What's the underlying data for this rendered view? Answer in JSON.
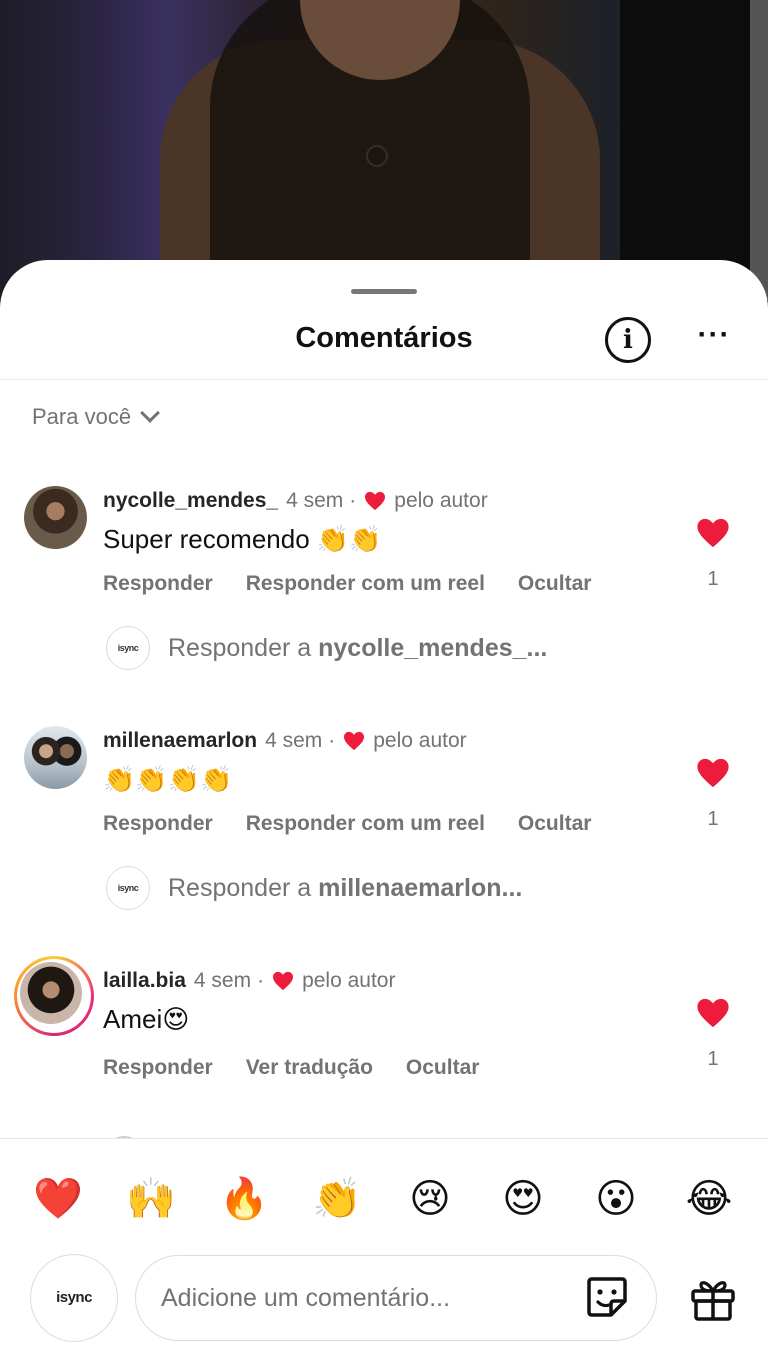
{
  "sheet": {
    "title": "Comentários",
    "info_icon": "info-icon",
    "more_icon": "more-horizontal-icon",
    "more_label": "···"
  },
  "filter": {
    "label": "Para você",
    "icon": "chevron-down-icon"
  },
  "comments": [
    {
      "username": "nycolle_mendes_",
      "time": "4 sem",
      "separator": "·",
      "liked_by_author": "pelo autor",
      "text": "Super recomendo 👏👏",
      "actions": [
        "Responder",
        "Responder com um reel",
        "Ocultar"
      ],
      "likes": "1",
      "reply_prompt": "Responder a ",
      "reply_user": "nycolle_mendes_...",
      "reply_avatar_text": "isync"
    },
    {
      "username": "millenaemarlon",
      "time": "4 sem",
      "separator": "·",
      "liked_by_author": "pelo autor",
      "text": "👏👏👏👏",
      "actions": [
        "Responder",
        "Responder com um reel",
        "Ocultar"
      ],
      "likes": "1",
      "reply_prompt": "Responder a ",
      "reply_user": "millenaemarlon...",
      "reply_avatar_text": "isync"
    },
    {
      "username": "lailla.bia",
      "time": "4 sem",
      "separator": "·",
      "liked_by_author": "pelo autor",
      "text": "Amei😍",
      "actions": [
        "Responder",
        "Ver tradução",
        "Ocultar"
      ],
      "likes": "1"
    }
  ],
  "reactions": [
    "❤️",
    "🙌",
    "🔥",
    "👏",
    "😢",
    "😍",
    "😮",
    "😂"
  ],
  "composer": {
    "avatar_text": "isync",
    "placeholder": "Adicione um comentário...",
    "sticker_icon": "sticker-icon",
    "gift_icon": "gift-icon"
  },
  "colors": {
    "heart": "#ed1c3c",
    "muted_text": "#737373",
    "primary_text": "#111111"
  }
}
